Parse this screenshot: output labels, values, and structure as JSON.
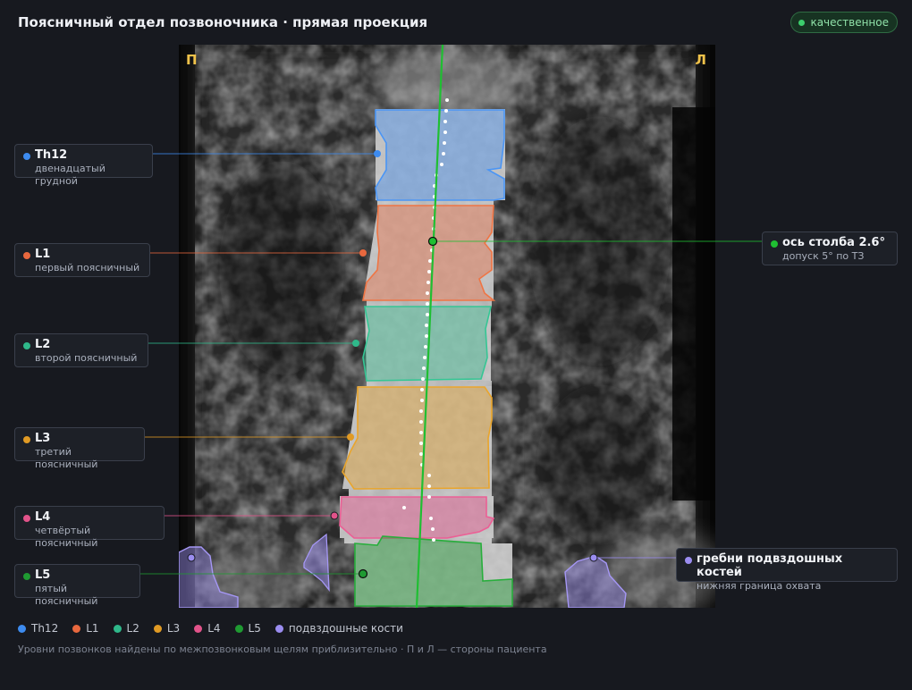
{
  "header": {
    "title": "Поясничный отдел позвоночника · прямая проекция",
    "quality_label": "качественное"
  },
  "viewer": {
    "orientation_left": "П",
    "orientation_right": "Л"
  },
  "labels": {
    "th12": {
      "name": "Th12",
      "sub": "двенадцатый грудной",
      "color": "#3d8bef"
    },
    "l1": {
      "name": "L1",
      "sub": "первый поясничный",
      "color": "#e8683e"
    },
    "l2": {
      "name": "L2",
      "sub": "второй поясничный",
      "color": "#2fb88a"
    },
    "l3": {
      "name": "L3",
      "sub": "третий поясничный",
      "color": "#e09a24"
    },
    "l4": {
      "name": "L4",
      "sub": "четвёртый поясничный",
      "color": "#e2538a"
    },
    "l5": {
      "name": "L5",
      "sub": "пятый поясничный",
      "color": "#1f9a32"
    },
    "axis": {
      "name": "ось столба 2.6°",
      "sub": "допуск 5° по ТЗ",
      "color": "#1fbf32"
    },
    "iliac": {
      "name": "гребни подвздошных костей",
      "sub": "нижняя граница охвата",
      "color": "#9b8df0"
    }
  },
  "legend": [
    {
      "label": "Th12",
      "color": "#3d8bef"
    },
    {
      "label": "L1",
      "color": "#e8683e"
    },
    {
      "label": "L2",
      "color": "#2fb88a"
    },
    {
      "label": "L3",
      "color": "#e09a24"
    },
    {
      "label": "L4",
      "color": "#e2538a"
    },
    {
      "label": "L5",
      "color": "#1f9a32"
    },
    {
      "label": "подвздошные кости",
      "color": "#9b8df0"
    }
  ],
  "footnote": "Уровни позвонков найдены по межпозвонковым щелям приблизительно · П и Л — стороны пациента"
}
